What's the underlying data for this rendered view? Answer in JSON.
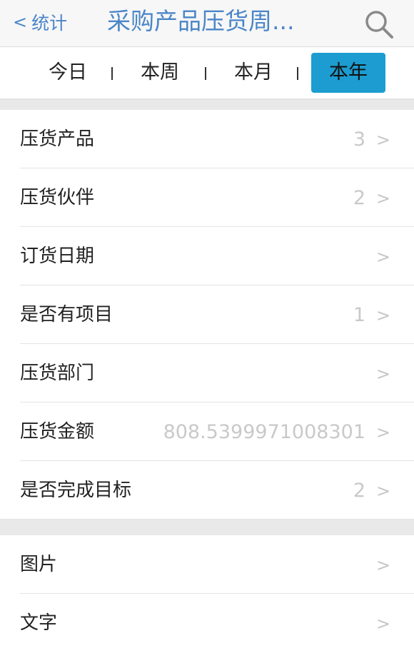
{
  "header": {
    "back_label": "统计",
    "back_chevron": "<",
    "title": "采购产品压货周...",
    "search_icon": "search-icon"
  },
  "period_tabs": [
    {
      "label": "今日",
      "active": false
    },
    {
      "label": "本周",
      "active": false
    },
    {
      "label": "本月",
      "active": false
    },
    {
      "label": "本年",
      "active": true
    }
  ],
  "section1": [
    {
      "label": "压货产品",
      "value": "3"
    },
    {
      "label": "压货伙伴",
      "value": "2"
    },
    {
      "label": "订货日期",
      "value": ""
    },
    {
      "label": "是否有项目",
      "value": "1"
    },
    {
      "label": "压货部门",
      "value": ""
    },
    {
      "label": "压货金额",
      "value": "808.5399971008301"
    },
    {
      "label": "是否完成目标",
      "value": "2"
    }
  ],
  "section2": [
    {
      "label": "图片",
      "value": ""
    },
    {
      "label": "文字",
      "value": ""
    }
  ],
  "arrow_glyph": ">",
  "colors": {
    "accent": "#4a86c8",
    "active_tab": "#1c9cd0",
    "muted_value": "#c9c9c9",
    "section_gap": "#e9e9e9"
  }
}
